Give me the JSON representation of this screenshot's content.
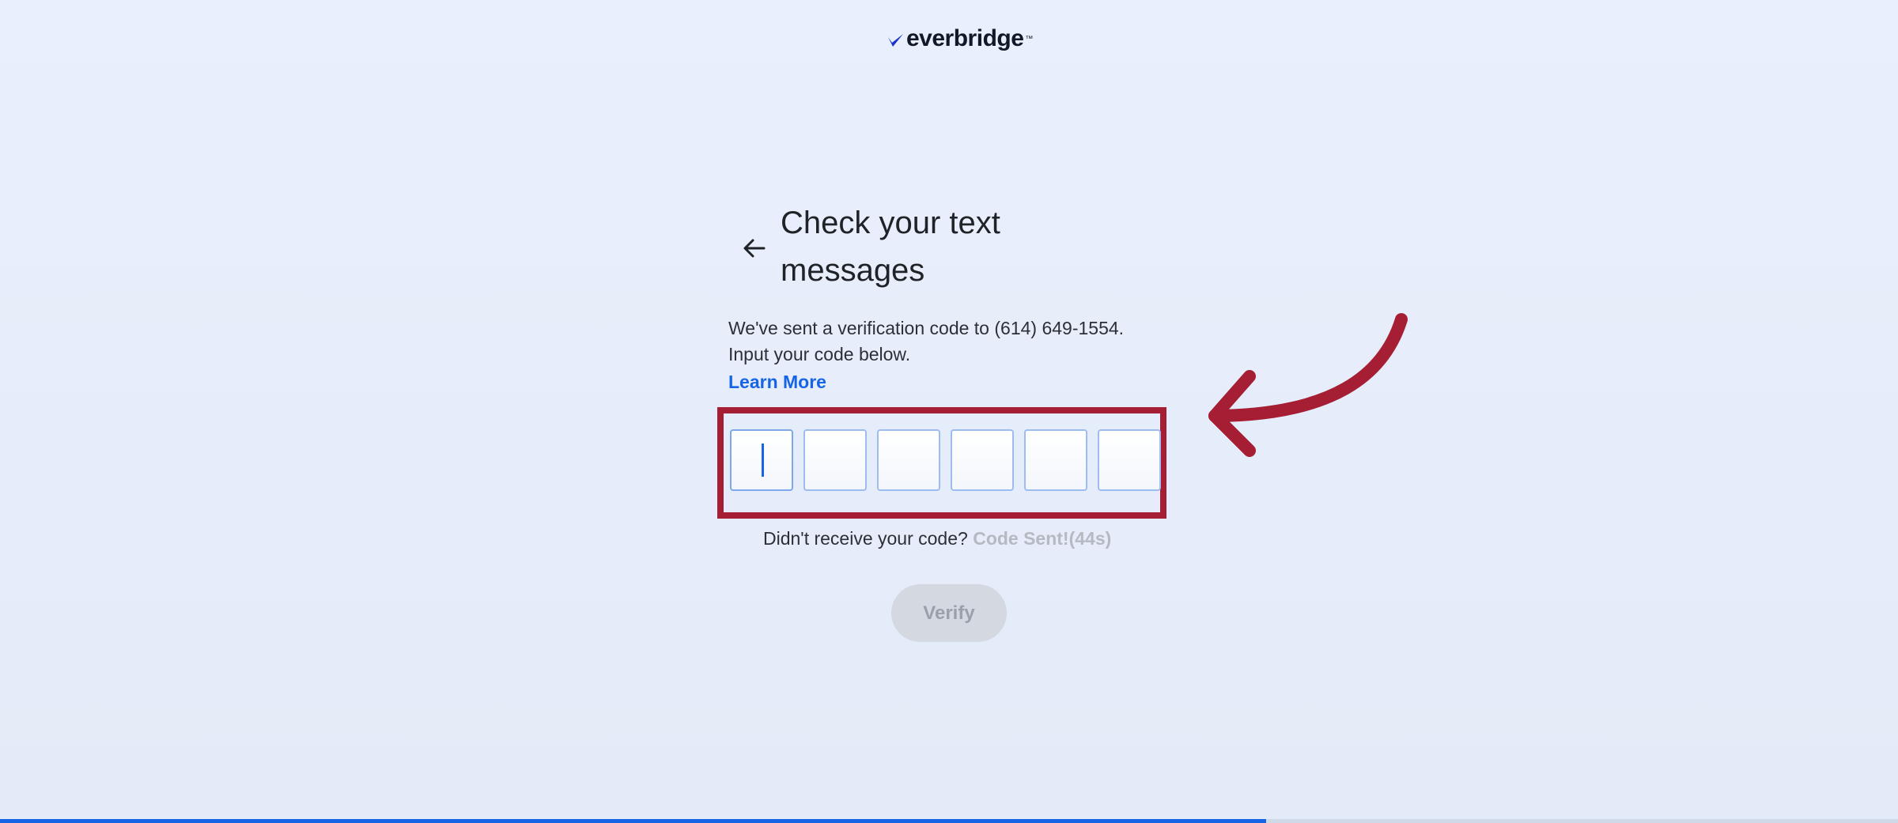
{
  "brand": {
    "name": "everbridge",
    "trademark": "™",
    "logo_color": "#1a33c9"
  },
  "header": {
    "title": "Check your text messages",
    "back_icon": "arrow-left-icon"
  },
  "message": {
    "line1": "We've sent a verification code to (614) 649-1554.",
    "line2": "Input your code below.",
    "learn_more": "Learn More"
  },
  "code_inputs": [
    {
      "value": ""
    },
    {
      "value": ""
    },
    {
      "value": ""
    },
    {
      "value": ""
    },
    {
      "value": ""
    },
    {
      "value": ""
    }
  ],
  "resend": {
    "prompt": "Didn't receive your code?",
    "status": "Code Sent!(44s)"
  },
  "verify_button": {
    "label": "Verify"
  },
  "annotation": {
    "arrow_icon": "curved-arrow-icon",
    "color": "#a51e34"
  },
  "progress": {
    "fraction": 0.667,
    "color": "#1565e6"
  }
}
